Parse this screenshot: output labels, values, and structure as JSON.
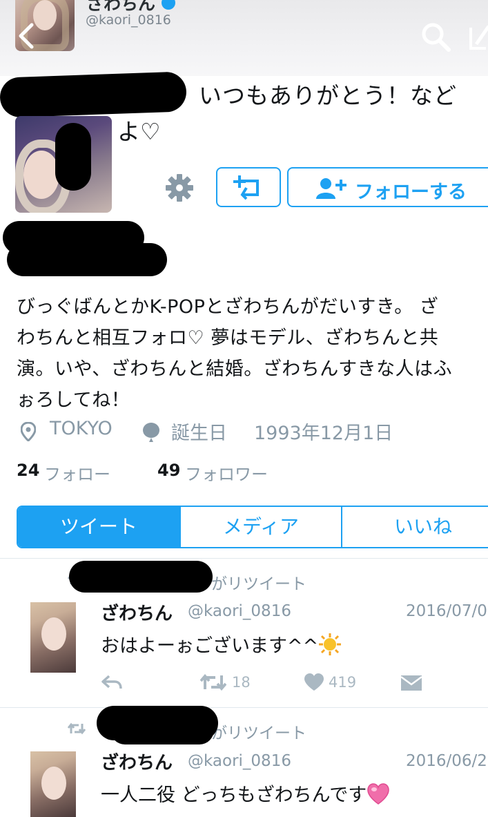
{
  "header": {
    "name": "ざわちん",
    "handle": "@kaori_0816"
  },
  "profile": {
    "bio_fragment_line1": "いつもありがとう！など",
    "bio_fragment_line2": "よ♡",
    "follow_label": "フォローする",
    "bio_lines": [
      "びっぐばんとかK-POPとざわちんがだいすき。 ざ",
      "わちんと相互フォロ♡ 夢はモデル、ざわちんと共",
      "演。いや、ざわちんと結婚。ざわちんすきな人はふ",
      "ぉろしてね！"
    ],
    "location": "TOKYO",
    "birthday_label": "誕生日",
    "birthday": "1993年12月1日",
    "following_count": "24",
    "following_label": "フォロー",
    "followers_count": "49",
    "followers_label": "フォロワー"
  },
  "tabs": {
    "tweets": "ツイート",
    "media": "メディア",
    "likes": "いいね"
  },
  "tweets": [
    {
      "retweet_label": "がリツイート",
      "name": "ざわちん",
      "handle": "@kaori_0816",
      "date": "2016/07/0",
      "text": "おはよーぉございます^^",
      "retweets": "18",
      "likes": "419"
    },
    {
      "retweet_label": "がリツイート",
      "name": "ざわちん",
      "handle": "@kaori_0816",
      "date": "2016/06/2",
      "text": "一人二役 どっちもざわちんです"
    }
  ],
  "colors": {
    "accent": "#1da1f2",
    "muted": "#8899a6",
    "redaction": "#000000"
  }
}
